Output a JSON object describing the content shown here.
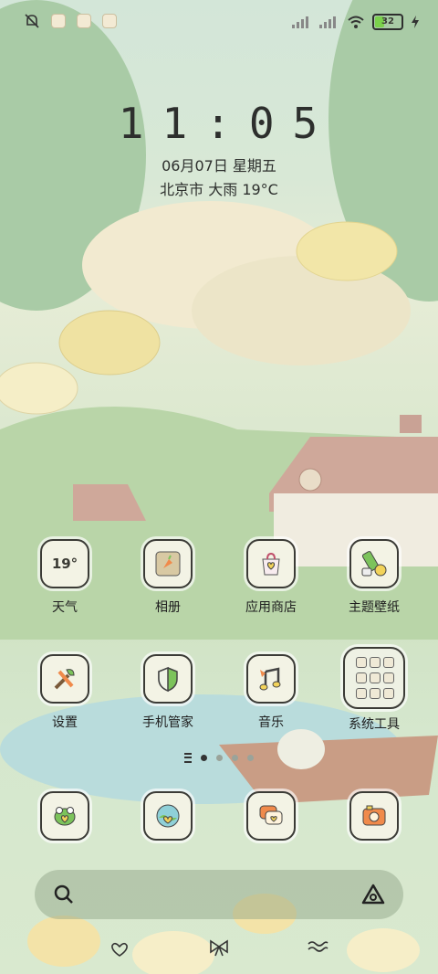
{
  "status_bar": {
    "battery_percent": "32",
    "battery_level": 0.32,
    "icons": [
      "mute-bell-icon",
      "notification-app-1",
      "notification-app-2",
      "notification-app-3",
      "signal-icon",
      "signal-icon",
      "wifi-icon",
      "battery-icon",
      "charging-icon"
    ]
  },
  "lockscreen": {
    "time": "11:05",
    "date": "06月07日 星期五",
    "weather": "北京市 大雨 19°C"
  },
  "apps_row1": [
    {
      "label": "天气",
      "icon": "weather-icon",
      "icon_text": "19°"
    },
    {
      "label": "相册",
      "icon": "gallery-icon"
    },
    {
      "label": "应用商店",
      "icon": "app-store-icon"
    },
    {
      "label": "主题壁纸",
      "icon": "theme-wallpaper-icon"
    }
  ],
  "apps_row2": [
    {
      "label": "设置",
      "icon": "settings-icon"
    },
    {
      "label": "手机管家",
      "icon": "security-icon"
    },
    {
      "label": "音乐",
      "icon": "music-icon"
    },
    {
      "label": "系统工具",
      "icon": "folder-icon"
    }
  ],
  "dock": [
    {
      "icon": "phone-icon"
    },
    {
      "icon": "browser-icon"
    },
    {
      "icon": "messages-icon"
    },
    {
      "icon": "camera-icon"
    }
  ],
  "pages": {
    "count": 4,
    "current": 1
  },
  "search_bar": {
    "left_icon": "search-icon",
    "right_icon": "assistant-icon"
  },
  "bottom_icons": [
    "heart-icon",
    "bow-icon",
    "wave-icon"
  ],
  "colors": {
    "icon_bg": "#f3f3e5",
    "icon_border": "#3b3b36",
    "accent_orange": "#f08a4b",
    "accent_yellow": "#f2d35a",
    "accent_green": "#7cc35b"
  }
}
